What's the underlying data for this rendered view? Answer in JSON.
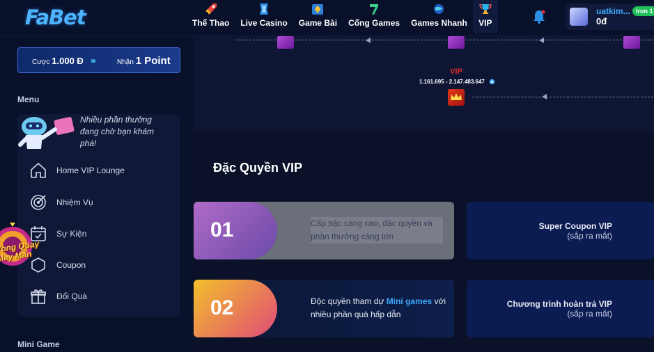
{
  "header": {
    "logo": "FaBet",
    "nav": [
      {
        "label": "Thể Thao",
        "icon": "rocket-icon"
      },
      {
        "label": "Live Casino",
        "icon": "casino-chip-icon"
      },
      {
        "label": "Game Bài",
        "icon": "spade-icon"
      },
      {
        "label": "Cổng Games",
        "icon": "slot-seven-icon"
      },
      {
        "label": "Games Nhanh",
        "icon": "globe-icon"
      },
      {
        "label": "VIP",
        "icon": "trophy-icon"
      }
    ],
    "user": {
      "name": "uatkim...",
      "balance": "0đ",
      "rank": "Iron 1"
    }
  },
  "sidebar": {
    "promo": {
      "bet_prefix": "Cược",
      "bet_amount": "1.000 Đ",
      "arrows": "›››",
      "receive_prefix": "Nhận",
      "receive_amount": "1 Point"
    },
    "menu_title": "Menu",
    "mascot_text": "Nhiều phần thưởng đang chờ bạn khám phá!",
    "items": [
      {
        "label": "Home VIP Lounge",
        "icon": "home-icon"
      },
      {
        "label": "Nhiệm Vụ",
        "icon": "target-icon"
      },
      {
        "label": "Sự Kiện",
        "icon": "calendar-icon"
      },
      {
        "label": "Coupon",
        "icon": "coupon-icon"
      },
      {
        "label": "Đổi Quà",
        "icon": "gift-icon"
      }
    ],
    "floating_badge": "Vòng Quay May Mắn",
    "mini_game_title": "Mini Game"
  },
  "track": {
    "vip_label": "VIP",
    "vip_range": "1.161.695 - 2.147.483.647"
  },
  "privileges": {
    "title": "Đặc Quyền VIP",
    "cards": [
      {
        "number": "01",
        "text": "Cấp bậc càng cao, đặc quyền và phần thưởng càng lớn"
      },
      {
        "number": "02",
        "text_before": "Độc quyền tham dự",
        "highlight": "Mini games",
        "text_after": "với nhiều phần quà hấp dẫn"
      }
    ],
    "right_cards": [
      {
        "title": "Super Coupon VIP",
        "status": "(sắp ra mắt)"
      },
      {
        "title": "Chương trình hoàn trả VIP",
        "status": "(sắp ra mắt)"
      }
    ]
  },
  "colors": {
    "accent": "#3fa9ff",
    "background": "#0a1128",
    "vip_red": "#e02a2a",
    "rank_green": "#1fbf5a"
  }
}
